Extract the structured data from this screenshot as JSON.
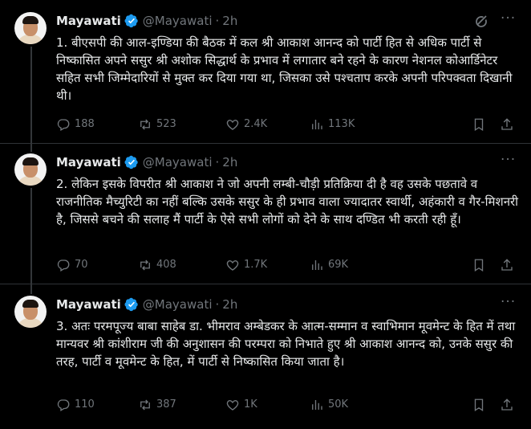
{
  "colors": {
    "background": "#000000",
    "text": "#e7e9ea",
    "muted": "#71767b",
    "verified": "#1d9bf0",
    "divider": "#2f3336"
  },
  "tweets": [
    {
      "author": {
        "name": "Mayawati",
        "handle": "@Mayawati",
        "time": "2h",
        "verified_icon": "verified-badge-icon",
        "avatar": "avatar"
      },
      "text": "1. बीएसपी की आल-इण्डिया की बैठक में कल श्री आकाश आनन्द को पार्टी हित से अधिक पार्टी से निष्कासित अपने ससुर श्री अशोक सिद्धार्थ के प्रभाव में लगातार बने रहने के कारण नेशनल कोआर्डिनेटर सहित सभी जिम्मेदारियों से मुक्त कर दिया गया था, जिसका उसे पश्चताप करके अपनी परिपक्वता दिखानी थी।",
      "stats": {
        "replies": "188",
        "reposts": "523",
        "likes": "2.4K",
        "views": "113K"
      }
    },
    {
      "author": {
        "name": "Mayawati",
        "handle": "@Mayawati",
        "time": "2h",
        "verified_icon": "verified-badge-icon",
        "avatar": "avatar"
      },
      "text": "2. लेकिन इसके विपरीत श्री आकाश ने जो अपनी लम्बी-चौड़ी प्रतिक्रिया दी है वह उसके पछतावे व राजनीतिक मैच्युरिटी का नहीं बल्कि उसके ससुर के ही प्रभाव वाला ज्यादातर स्वार्थी, अहंकारी व गैर-मिशनरी है, जिससे बचने की सलाह मैं पार्टी के ऐसे सभी लोगों को देने के साथ दण्डित भी करती रही हूँ।",
      "stats": {
        "replies": "70",
        "reposts": "408",
        "likes": "1.7K",
        "views": "69K"
      }
    },
    {
      "author": {
        "name": "Mayawati",
        "handle": "@Mayawati",
        "time": "2h",
        "verified_icon": "verified-badge-icon",
        "avatar": "avatar"
      },
      "text": "3. अतः परमपूज्य बाबा साहेब डा. भीमराव अम्बेडकर के आत्म-सम्मान व स्वाभिमान मूवमेन्ट के हित में तथा मान्यवर श्री कांशीराम जी की अनुशासन की परम्परा को निभाते हुए श्री आकाश आनन्द को, उनके ससुर की तरह, पार्टी व मूवमेन्ट के हित, में पार्टी से निष्कासित किया जाता है।",
      "stats": {
        "replies": "110",
        "reposts": "387",
        "likes": "1K",
        "views": "50K"
      }
    }
  ]
}
